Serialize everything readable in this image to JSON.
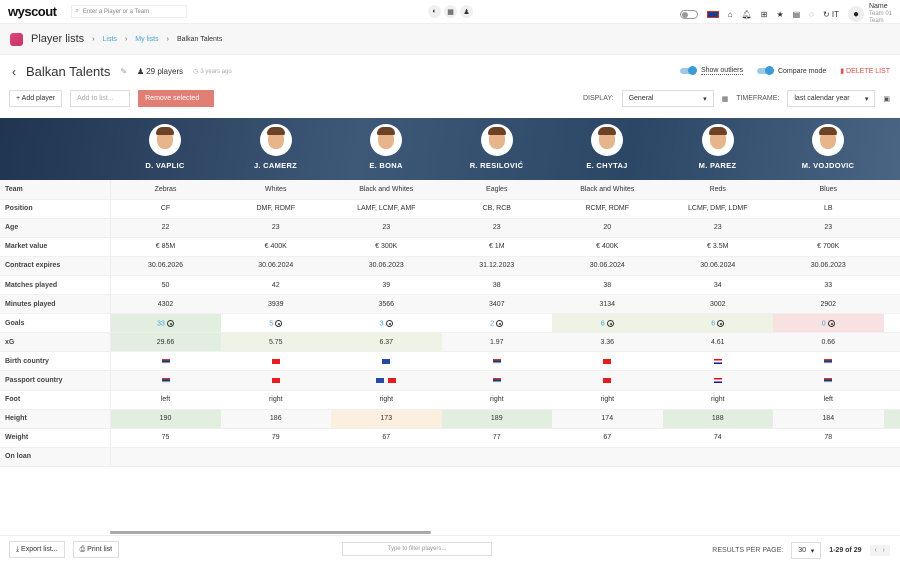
{
  "topbar": {
    "logo": "wyscout",
    "search_placeholder": "Enter a Player or a Team",
    "lang_code": "IT",
    "user_name": "Name",
    "user_team": "Team 01",
    "user_role": "Team"
  },
  "breadcrumb": {
    "app_title": "Player lists",
    "items": [
      "Lists",
      "My lists",
      "Balkan Talents"
    ]
  },
  "list": {
    "title": "Balkan Talents",
    "player_count": "29 players",
    "updated": "3 years ago"
  },
  "options": {
    "show_outliers": "Show outliers",
    "compare_mode": "Compare mode",
    "delete": "DELETE LIST",
    "show_outliers_on": true,
    "compare_mode_on": true
  },
  "actions": {
    "add_player": "+ Add player",
    "add_to_list": "Add to list...",
    "remove_selected": "Remove selected"
  },
  "display": {
    "label": "DISPLAY:",
    "value": "General",
    "timeframe_label": "TIMEFRAME:",
    "timeframe_value": "last calendar year"
  },
  "players": [
    "D. VAPLIC",
    "J. CAMERZ",
    "E. BONA",
    "R. RESILOVIĆ",
    "E. CHYTAJ",
    "M. PAREZ",
    "M. VOJDOVIC"
  ],
  "rows": [
    {
      "label": "Team",
      "values": [
        "Zebras",
        "Whites",
        "Black and Whites",
        "Eagles",
        "Black and Whites",
        "Reds",
        "Blues"
      ]
    },
    {
      "label": "Position",
      "values": [
        "CF",
        "DMF, RDMF",
        "LAMF, LCMF, AMF",
        "CB, RCB",
        "RCMF, RDMF",
        "LCMF, DMF, LDMF",
        "LB"
      ]
    },
    {
      "label": "Age",
      "values": [
        "22",
        "23",
        "23",
        "23",
        "20",
        "23",
        "23"
      ]
    },
    {
      "label": "Market value",
      "values": [
        "€ 85M",
        "€ 400K",
        "€ 300K",
        "€ 1M",
        "€ 400K",
        "€ 3.5M",
        "€ 700K"
      ]
    },
    {
      "label": "Contract expires",
      "values": [
        "30.06.2026",
        "30.06.2024",
        "30.06.2023",
        "31.12.2023",
        "30.06.2024",
        "30.06.2024",
        "30.06.2023"
      ]
    },
    {
      "label": "Matches played",
      "values": [
        "50",
        "42",
        "39",
        "38",
        "38",
        "34",
        "33"
      ]
    },
    {
      "label": "Minutes played",
      "values": [
        "4302",
        "3939",
        "3566",
        "3407",
        "3134",
        "3002",
        "2902"
      ]
    },
    {
      "label": "Goals",
      "values": [
        "33",
        "5",
        "3",
        "2",
        "6",
        "6",
        "0"
      ],
      "highlight": [
        "g1",
        "",
        "",
        "",
        "g2",
        "g2",
        "p"
      ]
    },
    {
      "label": "xG",
      "values": [
        "29.66",
        "5.75",
        "6.37",
        "1.97",
        "3.36",
        "4.61",
        "0.66"
      ],
      "highlight": [
        "g1",
        "g2",
        "g2",
        "",
        "",
        "",
        ""
      ]
    },
    {
      "label": "Birth country",
      "flags": [
        [
          "f-rs"
        ],
        [
          "f-al"
        ],
        [
          "f-xk"
        ],
        [
          "f-rs"
        ],
        [
          "f-al"
        ],
        [
          "f-hr"
        ],
        [
          "f-rs"
        ]
      ]
    },
    {
      "label": "Passport country",
      "flags": [
        [
          "f-rs"
        ],
        [
          "f-al"
        ],
        [
          "f-xk",
          "f-al"
        ],
        [
          "f-rs"
        ],
        [
          "f-al"
        ],
        [
          "f-hr"
        ],
        [
          "f-rs"
        ]
      ]
    },
    {
      "label": "Foot",
      "values": [
        "left",
        "right",
        "right",
        "right",
        "right",
        "right",
        "left"
      ]
    },
    {
      "label": "Height",
      "values": [
        "190",
        "186",
        "173",
        "189",
        "174",
        "188",
        "184"
      ],
      "highlight": [
        "g1",
        "",
        "o",
        "g1",
        "",
        "g1",
        ""
      ]
    },
    {
      "label": "Weight",
      "values": [
        "75",
        "79",
        "67",
        "77",
        "67",
        "74",
        "78"
      ]
    },
    {
      "label": "On loan",
      "values": [
        "",
        "",
        "",
        "",
        "",
        "",
        ""
      ]
    }
  ],
  "footer": {
    "export": "Export list...",
    "print": "Print list",
    "filter_placeholder": "Type to filter players...",
    "rpp_label": "RESULTS PER PAGE:",
    "rpp_value": "30",
    "range": "1-29 of 29"
  }
}
